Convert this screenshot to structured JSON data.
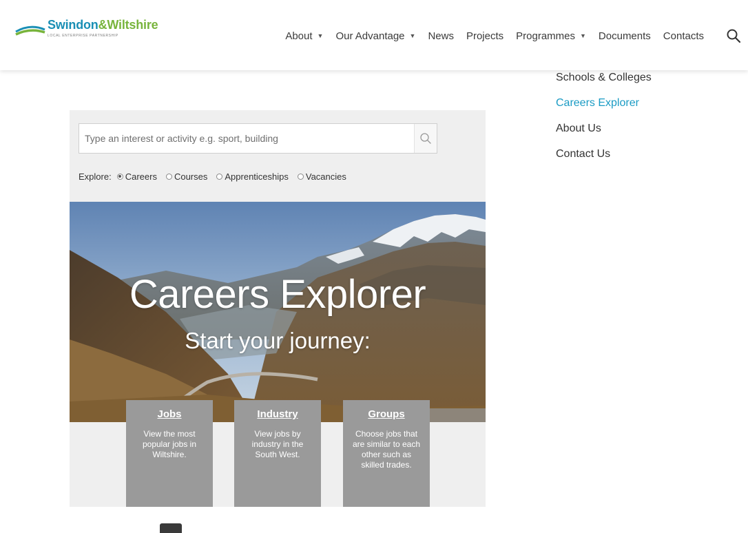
{
  "logo": {
    "name_part1": "Swindon",
    "name_part2": "&Wiltshire",
    "tagline": "LOCAL ENTERPRISE PARTNERSHIP"
  },
  "nav": {
    "items": [
      {
        "label": "About",
        "has_dropdown": true
      },
      {
        "label": "Our Advantage",
        "has_dropdown": true
      },
      {
        "label": "News",
        "has_dropdown": false
      },
      {
        "label": "Projects",
        "has_dropdown": false
      },
      {
        "label": "Programmes",
        "has_dropdown": true
      },
      {
        "label": "Documents",
        "has_dropdown": false
      },
      {
        "label": "Contacts",
        "has_dropdown": false
      }
    ],
    "search_icon": "search-icon"
  },
  "submenu": {
    "items": [
      {
        "label": "Schools & Colleges"
      },
      {
        "label": "Careers Explorer",
        "active": true
      },
      {
        "label": "About Us"
      },
      {
        "label": "Contact Us"
      }
    ]
  },
  "widget": {
    "search": {
      "placeholder": "Type an interest or activity e.g. sport, building",
      "value": ""
    },
    "explore": {
      "label": "Explore:",
      "options": [
        {
          "label": "Careers",
          "checked": true
        },
        {
          "label": "Courses",
          "checked": false
        },
        {
          "label": "Apprenticeships",
          "checked": false
        },
        {
          "label": "Vacancies",
          "checked": false
        }
      ]
    },
    "hero": {
      "title": "Careers Explorer",
      "subtitle": "Start your journey:"
    },
    "cards": [
      {
        "title": "Jobs",
        "description": "View the most popular jobs in Wiltshire."
      },
      {
        "title": "Industry",
        "description": "View jobs by industry in the South West."
      },
      {
        "title": "Groups",
        "description": "Choose jobs that are similar to each other such as skilled trades."
      }
    ]
  },
  "colors": {
    "brand_blue": "#1a8fb5",
    "brand_green": "#78b43c",
    "active_link": "#1a9bc4",
    "card_bg": "#9a9a9a",
    "widget_bg": "#efefef"
  }
}
